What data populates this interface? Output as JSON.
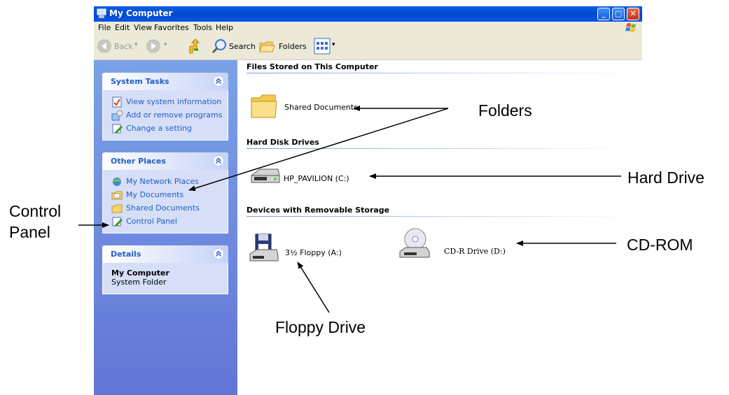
{
  "window": {
    "title": "My Computer",
    "controls": {
      "minimize": "_",
      "maximize": "□",
      "close": "✕"
    }
  },
  "menubar": {
    "items": [
      "File",
      "Edit",
      "View",
      "Favorites",
      "Tools",
      "Help"
    ]
  },
  "toolbar": {
    "back_label": "Back",
    "search_label": "Search",
    "folders_label": "Folders"
  },
  "sidebar": {
    "system_tasks": {
      "title": "System Tasks",
      "items": [
        {
          "label": "View system information",
          "icon": "system-info-icon"
        },
        {
          "label": "Add or remove programs",
          "icon": "add-remove-programs-icon"
        },
        {
          "label": "Change a setting",
          "icon": "change-setting-icon"
        }
      ]
    },
    "other_places": {
      "title": "Other Places",
      "items": [
        {
          "label": "My Network Places",
          "icon": "network-places-icon"
        },
        {
          "label": "My Documents",
          "icon": "my-documents-icon"
        },
        {
          "label": "Shared Documents",
          "icon": "shared-documents-icon"
        },
        {
          "label": "Control Panel",
          "icon": "control-panel-icon"
        }
      ]
    },
    "details": {
      "title": "Details",
      "name": "My Computer",
      "type": "System Folder"
    }
  },
  "content": {
    "groups": [
      {
        "header": "Files Stored on This Computer",
        "items": [
          {
            "label": "Shared Documents",
            "icon": "folder-icon"
          }
        ]
      },
      {
        "header": "Hard Disk Drives",
        "items": [
          {
            "label": "HP_PAVILION (C:)",
            "icon": "hard-drive-icon"
          }
        ]
      },
      {
        "header": "Devices with Removable Storage",
        "items": [
          {
            "label": "3½ Floppy (A:)",
            "icon": "floppy-drive-icon"
          },
          {
            "label": "CD-R Drive (D:)",
            "icon": "cd-drive-icon"
          }
        ]
      }
    ]
  },
  "annotations": {
    "folders": "Folders",
    "hard_drive": "Hard Drive",
    "cd_rom": "CD-ROM",
    "floppy_drive": "Floppy Drive",
    "control_panel_line1": "Control",
    "control_panel_line2": "Panel"
  }
}
